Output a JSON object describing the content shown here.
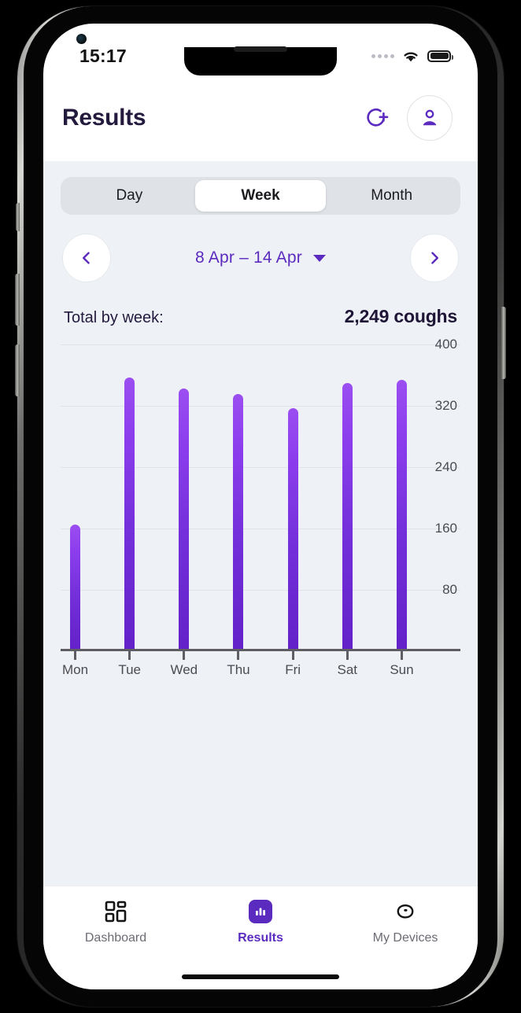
{
  "status_bar": {
    "time": "15:17",
    "cellular_icon": "cellular-dots-icon",
    "wifi_icon": "wifi-icon",
    "battery_icon": "battery-full-icon"
  },
  "header": {
    "title": "Results",
    "add_device_icon": "add-circle-icon",
    "profile_icon": "person-icon"
  },
  "segmented": {
    "options": [
      {
        "label": "Day",
        "active": false
      },
      {
        "label": "Week",
        "active": true
      },
      {
        "label": "Month",
        "active": false
      }
    ]
  },
  "date_nav": {
    "prev_icon": "chevron-left-icon",
    "next_icon": "chevron-right-icon",
    "range_label": "8 Apr – 14 Apr",
    "dropdown_icon": "caret-down-icon"
  },
  "summary": {
    "label": "Total by week:",
    "value": "2,249 coughs"
  },
  "tabbar": {
    "items": [
      {
        "label": "Dashboard",
        "icon": "grid-icon",
        "active": false
      },
      {
        "label": "Results",
        "icon": "bar-chart-icon",
        "active": true
      },
      {
        "label": "My Devices",
        "icon": "device-icon",
        "active": false
      }
    ]
  },
  "colors": {
    "accent": "#5b2bbf",
    "bar_top": "#9b4ef0",
    "bar_bottom": "#6221c9",
    "content_bg": "#eef1f5",
    "segment_track": "#dfe2e7",
    "title_text": "#231a3e"
  },
  "chart_data": {
    "type": "bar",
    "title": "",
    "xlabel": "",
    "ylabel": "",
    "categories": [
      "Mon",
      "Tue",
      "Wed",
      "Thu",
      "Fri",
      "Sat",
      "Sun"
    ],
    "values": [
      165,
      357,
      343,
      335,
      317,
      350,
      354
    ],
    "yticks": [
      400,
      320,
      240,
      160,
      80
    ],
    "ylim": [
      0,
      400
    ],
    "grid": true,
    "legend": "none",
    "unit": "coughs",
    "total": 2249
  }
}
